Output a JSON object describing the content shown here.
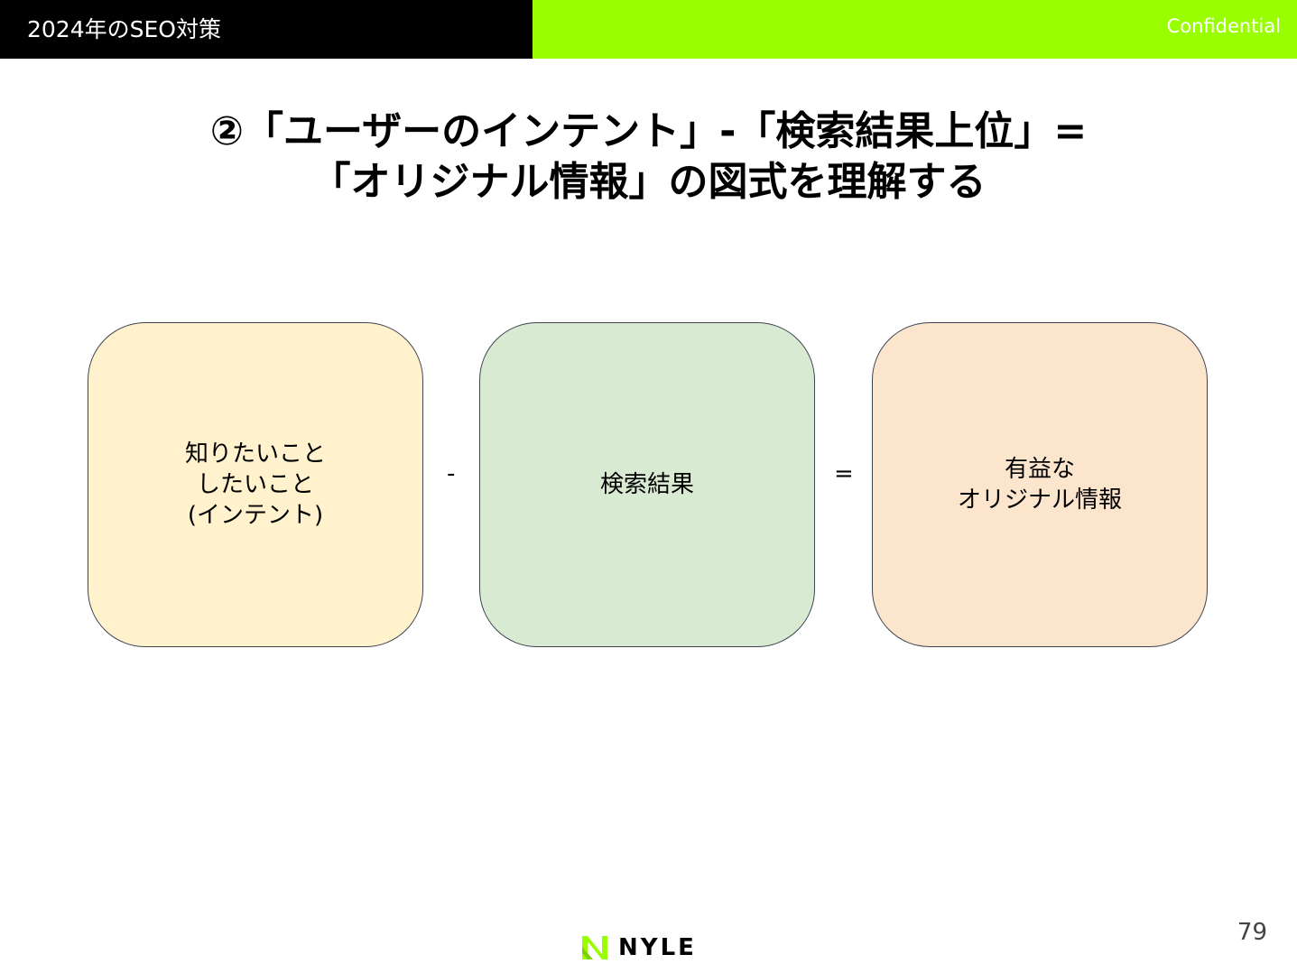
{
  "header": {
    "section_title": "2024年のSEO対策",
    "confidential_label": "Confidential"
  },
  "slide": {
    "title_line1": "②「ユーザーのインテント」-「検索結果上位」=",
    "title_line2": "「オリジナル情報」の図式を理解する"
  },
  "diagram": {
    "box_intent": [
      "知りたいこと",
      "したいこと",
      "(インテント)"
    ],
    "minus_operator": "-",
    "box_search_results": "検索結果",
    "equals_operator": "=",
    "box_original_info": [
      "有益な",
      "オリジナル情報"
    ]
  },
  "footer": {
    "logo_text": "NYLE",
    "page_number": "79"
  },
  "colors": {
    "accent": "#99ff00",
    "box_intent": "#fff2cc",
    "box_search_results": "#d9ead3",
    "box_original_info": "#fce5cd"
  }
}
